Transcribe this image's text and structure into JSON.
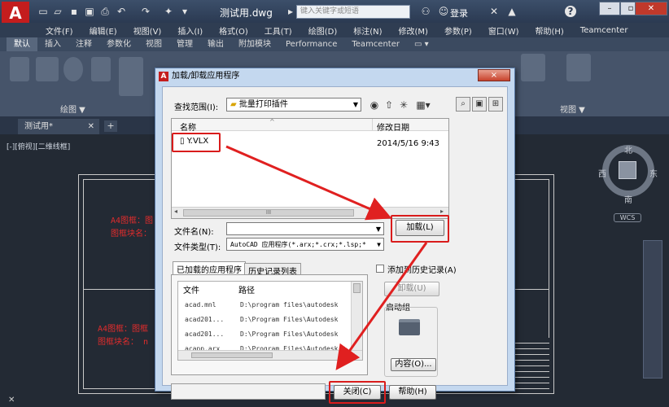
{
  "app": {
    "logo_letter": "A",
    "document_title": "测试用.dwg",
    "search_placeholder": "键入关键字或短语",
    "login_label": "登录",
    "help_label": "?"
  },
  "menu": [
    "文件(F)",
    "编辑(E)",
    "视图(V)",
    "插入(I)",
    "格式(O)",
    "工具(T)",
    "绘图(D)",
    "标注(N)",
    "修改(M)",
    "参数(P)",
    "窗口(W)",
    "帮助(H)",
    "Teamcenter"
  ],
  "ribbon_tabs": [
    "默认",
    "插入",
    "注释",
    "参数化",
    "视图",
    "管理",
    "输出",
    "附加模块",
    "Performance",
    "Teamcenter"
  ],
  "ribbon_panels": {
    "draw": "绘图 ▼",
    "view": "视图 ▼"
  },
  "doc_tab": {
    "name": "测试用*",
    "add": "+"
  },
  "canvas": {
    "viewport_label": "[-][俯视][二维线框]",
    "frame_text_1a": "A4图框：图",
    "frame_text_1b": "图框块名：",
    "frame_text_2a": "A4图框：图框",
    "frame_text_2b": "图框块名： n",
    "compass": {
      "n": "北",
      "s": "南",
      "e": "东",
      "w": "西"
    },
    "wcs": "WCS"
  },
  "dialog": {
    "title": "加载/卸载应用程序",
    "close": "×",
    "look_in_label": "查找范围(I):",
    "look_in_value": "批量打印插件",
    "col_name": "名称",
    "col_modified": "修改日期",
    "file_name": "Y.VLX",
    "file_date": "2014/5/16 9:43",
    "hscroll_mid": "III",
    "filename_label": "文件名(N):",
    "filename_value": "",
    "filetype_label": "文件类型(T):",
    "filetype_value": "AutoCAD 应用程序(*.arx;*.crx;*.lsp;*",
    "load_button": "加载(L)",
    "tab_loaded": "已加载的应用程序",
    "tab_history": "历史记录列表",
    "add_history": "添加到历史记录(A)",
    "loaded_col_file": "文件",
    "loaded_col_path": "路径",
    "loaded_rows": [
      {
        "file": "acad.mnl",
        "path": "D:\\program files\\autodesk"
      },
      {
        "file": "acad201...",
        "path": "D:\\Program Files\\Autodesk"
      },
      {
        "file": "acad201...",
        "path": "D:\\Program Files\\Autodesk"
      },
      {
        "file": "acapp.arx",
        "path": "D:\\Program Files\\Autodesk"
      }
    ],
    "unload_button": "卸载(U)",
    "startup_label": "启动组",
    "contents_button": "内容(O)...",
    "close_button": "关闭(C)",
    "help_button": "帮助(H)"
  }
}
